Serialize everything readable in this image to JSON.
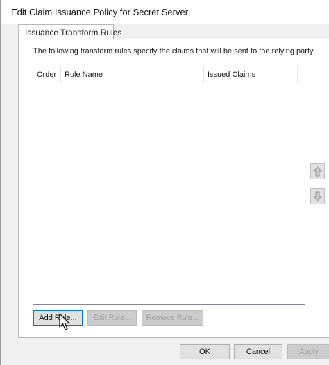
{
  "window": {
    "title": "Edit Claim Issuance Policy for Secret Server"
  },
  "tabs": [
    {
      "label": "Issuance Transform Rules",
      "selected": true
    }
  ],
  "panel": {
    "description": "The following transform rules specify the claims that will be sent to the relying party.",
    "columns": [
      "Order",
      "Rule Name",
      "Issued Claims"
    ],
    "rows": []
  },
  "side_buttons": {
    "move_up": "arrow-up-icon",
    "move_down": "arrow-down-icon"
  },
  "rule_buttons": {
    "add": "Add Rule...",
    "edit": "Edit Rule...",
    "remove": "Remove Rule..."
  },
  "dialog_buttons": {
    "ok": "OK",
    "cancel": "Cancel",
    "apply": "Apply"
  },
  "colors": {
    "focus_border": "#0078d7",
    "dialog_bg": "#f0f0f0"
  }
}
